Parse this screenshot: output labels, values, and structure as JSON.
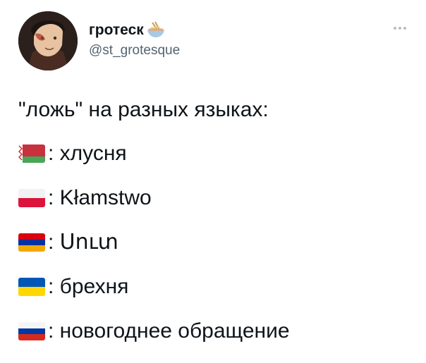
{
  "author": {
    "display_name": "гротеск",
    "handle": "@st_grotesque",
    "name_emoji": "ramen-bowl-icon"
  },
  "tweet": {
    "intro": "\"ложь\" на разных языках:",
    "items": [
      {
        "flag": "belarus-flag-icon",
        "text": ": хлусня"
      },
      {
        "flag": "poland-flag-icon",
        "text": ": Kłamstwo"
      },
      {
        "flag": "armenia-flag-icon",
        "text": ": Սուտ"
      },
      {
        "flag": "ukraine-flag-icon",
        "text": ": брехня"
      },
      {
        "flag": "russia-flag-icon",
        "text": ": новогоднее обращение"
      }
    ]
  },
  "colors": {
    "text": "#0f1419",
    "secondary": "#536471"
  }
}
